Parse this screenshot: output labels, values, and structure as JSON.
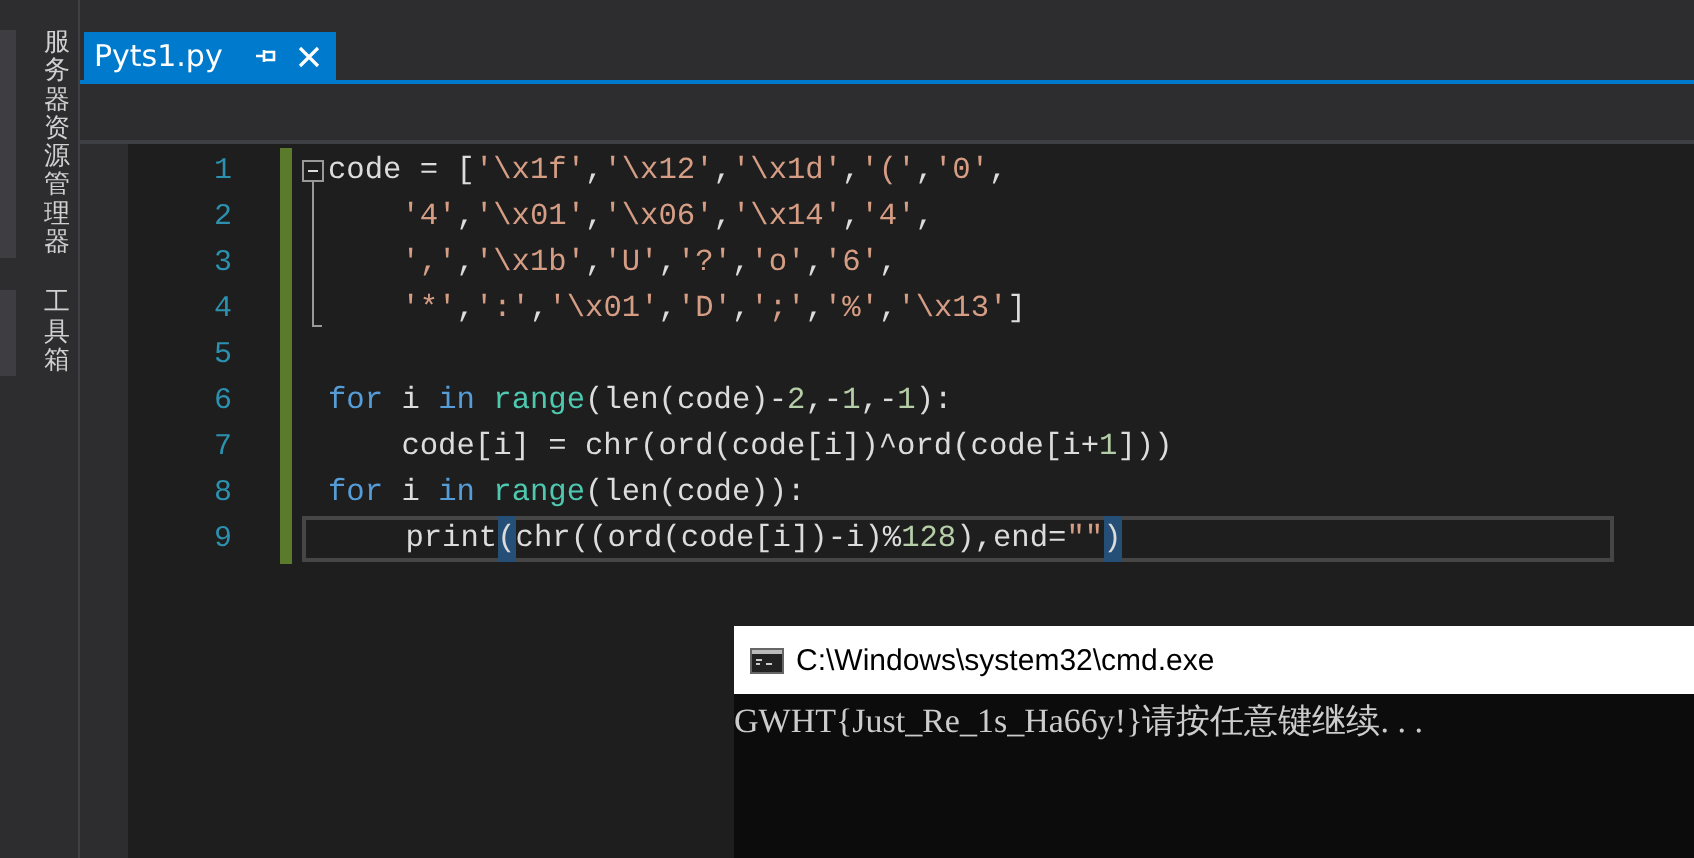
{
  "side_panel": {
    "tabs": [
      {
        "label": "服务器资源管理器"
      },
      {
        "label": "工具箱"
      }
    ]
  },
  "editor_tabs": [
    {
      "label": "Pyts1.py",
      "selected": true
    }
  ],
  "editor": {
    "lines": [
      {
        "number": "1",
        "collapsible": true,
        "indent": false,
        "current": false,
        "tokens": [
          {
            "kind": "plain",
            "text": "code = ["
          },
          {
            "kind": "string",
            "text": "'\\x1f'"
          },
          {
            "kind": "plain",
            "text": ","
          },
          {
            "kind": "string",
            "text": "'\\x12'"
          },
          {
            "kind": "plain",
            "text": ","
          },
          {
            "kind": "string",
            "text": "'\\x1d'"
          },
          {
            "kind": "plain",
            "text": ","
          },
          {
            "kind": "string",
            "text": "'('"
          },
          {
            "kind": "plain",
            "text": ","
          },
          {
            "kind": "string",
            "text": "'0'"
          },
          {
            "kind": "plain",
            "text": ","
          }
        ]
      },
      {
        "number": "2",
        "collapsible": false,
        "in_fold": true,
        "indent": true,
        "current": false,
        "tokens": [
          {
            "kind": "string",
            "text": "'4'"
          },
          {
            "kind": "plain",
            "text": ","
          },
          {
            "kind": "string",
            "text": "'\\x01'"
          },
          {
            "kind": "plain",
            "text": ","
          },
          {
            "kind": "string",
            "text": "'\\x06'"
          },
          {
            "kind": "plain",
            "text": ","
          },
          {
            "kind": "string",
            "text": "'\\x14'"
          },
          {
            "kind": "plain",
            "text": ","
          },
          {
            "kind": "string",
            "text": "'4'"
          },
          {
            "kind": "plain",
            "text": ","
          }
        ]
      },
      {
        "number": "3",
        "collapsible": false,
        "in_fold": true,
        "indent": true,
        "current": false,
        "tokens": [
          {
            "kind": "string",
            "text": "','"
          },
          {
            "kind": "plain",
            "text": ","
          },
          {
            "kind": "string",
            "text": "'\\x1b'"
          },
          {
            "kind": "plain",
            "text": ","
          },
          {
            "kind": "string",
            "text": "'U'"
          },
          {
            "kind": "plain",
            "text": ","
          },
          {
            "kind": "string",
            "text": "'?'"
          },
          {
            "kind": "plain",
            "text": ","
          },
          {
            "kind": "string",
            "text": "'o'"
          },
          {
            "kind": "plain",
            "text": ","
          },
          {
            "kind": "string",
            "text": "'6'"
          },
          {
            "kind": "plain",
            "text": ","
          }
        ]
      },
      {
        "number": "4",
        "collapsible": false,
        "in_fold": true,
        "indent": true,
        "current": false,
        "tokens": [
          {
            "kind": "string",
            "text": "'*'"
          },
          {
            "kind": "plain",
            "text": ","
          },
          {
            "kind": "string",
            "text": "':'"
          },
          {
            "kind": "plain",
            "text": ","
          },
          {
            "kind": "string",
            "text": "'\\x01'"
          },
          {
            "kind": "plain",
            "text": ","
          },
          {
            "kind": "string",
            "text": "'D'"
          },
          {
            "kind": "plain",
            "text": ","
          },
          {
            "kind": "string",
            "text": "';'"
          },
          {
            "kind": "plain",
            "text": ","
          },
          {
            "kind": "string",
            "text": "'%'"
          },
          {
            "kind": "plain",
            "text": ","
          },
          {
            "kind": "string",
            "text": "'\\x13'"
          },
          {
            "kind": "plain",
            "text": "]"
          }
        ]
      },
      {
        "number": "5",
        "collapsible": false,
        "in_fold": false,
        "current": false
      },
      {
        "number": "6",
        "collapsible": false,
        "in_fold": false,
        "indent": false,
        "current": false,
        "tokens": [
          {
            "kind": "keyword",
            "text": "for"
          },
          {
            "kind": "plain",
            "text": " i "
          },
          {
            "kind": "keyword",
            "text": "in "
          },
          {
            "kind": "builtin",
            "text": "range"
          },
          {
            "kind": "plain",
            "text": "(len(code)-"
          },
          {
            "kind": "number",
            "text": "2"
          },
          {
            "kind": "plain",
            "text": ",-"
          },
          {
            "kind": "number",
            "text": "1"
          },
          {
            "kind": "plain",
            "text": ",-"
          },
          {
            "kind": "number",
            "text": "1"
          },
          {
            "kind": "plain",
            "text": "):"
          }
        ]
      },
      {
        "number": "7",
        "collapsible": false,
        "in_fold": false,
        "indent": true,
        "current": false,
        "tokens": [
          {
            "kind": "plain",
            "text": "code[i] = chr(ord(code[i])^ord(code[i+"
          },
          {
            "kind": "number",
            "text": "1"
          },
          {
            "kind": "plain",
            "text": "]))"
          }
        ]
      },
      {
        "number": "8",
        "collapsible": false,
        "in_fold": false,
        "indent": false,
        "current": false,
        "tokens": [
          {
            "kind": "keyword",
            "text": "for"
          },
          {
            "kind": "plain",
            "text": " i "
          },
          {
            "kind": "keyword",
            "text": "in "
          },
          {
            "kind": "builtin",
            "text": "range"
          },
          {
            "kind": "plain",
            "text": "(len(code)):"
          }
        ]
      },
      {
        "number": "9",
        "collapsible": false,
        "in_fold": false,
        "indent": true,
        "current": true,
        "tokens": [
          {
            "kind": "plain",
            "text": "print"
          },
          {
            "kind": "brace",
            "text": "("
          },
          {
            "kind": "plain",
            "text": "chr((ord(code[i])-i)%"
          },
          {
            "kind": "number",
            "text": "128"
          },
          {
            "kind": "plain",
            "text": "),end="
          },
          {
            "kind": "string",
            "text": "\"\""
          },
          {
            "kind": "brace",
            "text": ")"
          }
        ]
      }
    ]
  },
  "console": {
    "title": "C:\\Windows\\system32\\cmd.exe",
    "output": "GWHT{Just_Re_1s_Ha66y!}请按任意键继续. . ."
  }
}
